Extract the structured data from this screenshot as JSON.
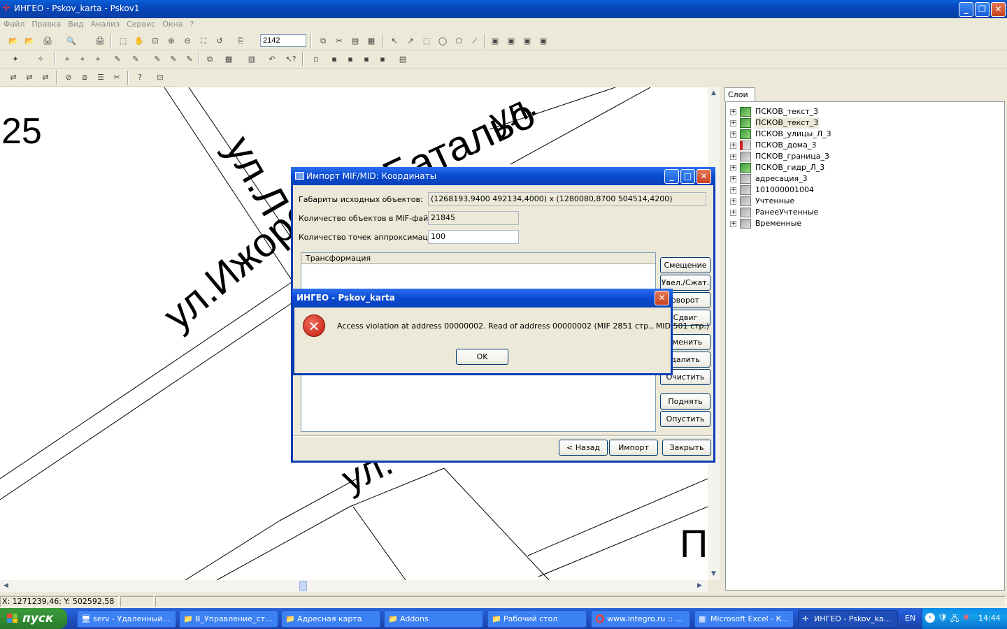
{
  "window": {
    "title": "ИНГЕО - Pskov_karta - Pskov1",
    "app_icon": "ingeo-app-icon"
  },
  "menu": [
    "Файл",
    "Правка",
    "Вид",
    "Анализ",
    "Сервис",
    "Окна",
    "?"
  ],
  "toolbar": {
    "scale_value": "2142"
  },
  "map": {
    "labels": [
      "25",
      "ул.Л",
      "Батальо",
      "ул.",
      "ул.Ижорс",
      "ул.",
      "П"
    ]
  },
  "layers": {
    "tab": "Слои",
    "items": [
      {
        "name": "ПСКОВ_текст_3",
        "icon": "green-layer-icon",
        "selected": false
      },
      {
        "name": "ПСКОВ_текст_3",
        "icon": "green-layer-icon",
        "selected": true
      },
      {
        "name": "ПСКОВ_улицы_Л_3",
        "icon": "green-layer-icon",
        "selected": false
      },
      {
        "name": "ПСКОВ_дома_3",
        "icon": "red-layer-icon",
        "selected": false
      },
      {
        "name": "ПСКОВ_граница_3",
        "icon": "grey-layer-icon",
        "selected": false
      },
      {
        "name": "ПСКОВ_гидр_Л_3",
        "icon": "green-layer-icon",
        "selected": false
      },
      {
        "name": "адресация_3",
        "icon": "grey-layer-icon",
        "selected": false
      },
      {
        "name": "101000001004",
        "icon": "grey-layer-icon",
        "selected": false
      },
      {
        "name": "Учтенные",
        "icon": "grey-layer-icon",
        "selected": false
      },
      {
        "name": "РанееУчтенные",
        "icon": "grey-layer-icon",
        "selected": false
      },
      {
        "name": "Временные",
        "icon": "grey-layer-icon",
        "selected": false
      }
    ]
  },
  "status": {
    "coords": "X: 1271239,46; Y: 502592,58"
  },
  "import_dialog": {
    "title": "Импорт MIF/MID: Координаты",
    "extent_label": "Габариты исходных объектов:",
    "extent_value": "(1268193,9400  492134,4000) x (1280080,8700  504514,4200)",
    "count_label": "Количество объектов в MIF-файле:",
    "count_value": "21845",
    "approx_label": "Количество точек аппроксимации:",
    "approx_value": "100",
    "transform_header": "Трансформация",
    "side_buttons": [
      "Смещение",
      "Увел./Сжат.",
      "оворот",
      "Сдвиг",
      "зменить",
      "далить",
      "Очистить",
      "Поднять",
      "Опустить"
    ],
    "back_button": "< Назад",
    "import_button": "Импорт",
    "close_button": "Закрыть"
  },
  "error_dialog": {
    "title": "ИНГЕО - Pskov_karta",
    "message": "Access violation at address 00000002. Read of address 00000002 (MIF 2851 стр., MID 501 стр.)",
    "ok_button": "OK"
  },
  "taskbar": {
    "start_label": "пуск",
    "tasks": [
      {
        "label": "serv - Удаленный...",
        "icon": "remote-desktop-icon",
        "active": false
      },
      {
        "label": "В_Управление_ст...",
        "icon": "folder-icon",
        "active": false
      },
      {
        "label": "Адресная карта",
        "icon": "folder-icon",
        "active": false
      },
      {
        "label": "Addons",
        "icon": "folder-icon",
        "active": false
      },
      {
        "label": "Рабочий стол",
        "icon": "folder-icon",
        "active": false
      },
      {
        "label": "www.integro.ru :: ...",
        "icon": "opera-icon",
        "active": false
      },
      {
        "label": "Microsoft Excel - К...",
        "icon": "excel-icon",
        "active": false
      },
      {
        "label": "ИНГЕО - Pskov_ka...",
        "icon": "ingeo-app-icon",
        "active": true
      }
    ],
    "lang": "EN",
    "clock": "14:44"
  }
}
